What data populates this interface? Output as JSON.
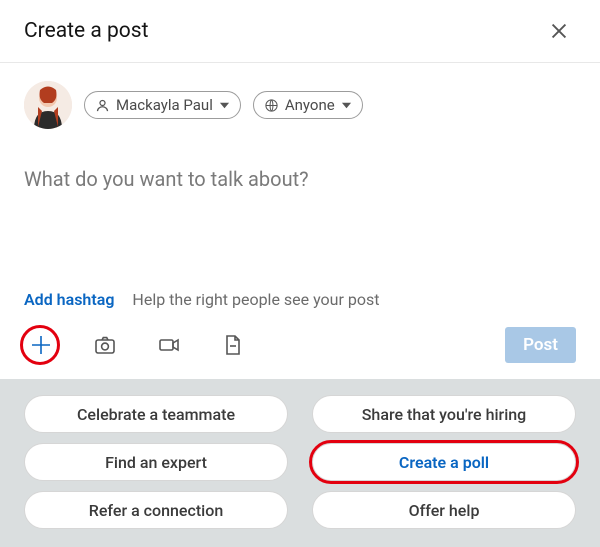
{
  "header": {
    "title": "Create a post"
  },
  "author": {
    "name": "Mackayla Paul",
    "visibility": "Anyone"
  },
  "composer": {
    "placeholder": "What do you want to talk about?"
  },
  "hashtag": {
    "add_label": "Add hashtag",
    "help_text": "Help the right people see your post"
  },
  "post_button": {
    "label": "Post",
    "enabled": false
  },
  "options": [
    "Celebrate a teammate",
    "Share that you're hiring",
    "Find an expert",
    "Create a poll",
    "Refer a connection",
    "Offer help"
  ],
  "highlighted_option_index": 3,
  "colors": {
    "accent": "#0a66c2",
    "highlight_ring": "#e3000f",
    "panel_bg": "#dadedf"
  }
}
